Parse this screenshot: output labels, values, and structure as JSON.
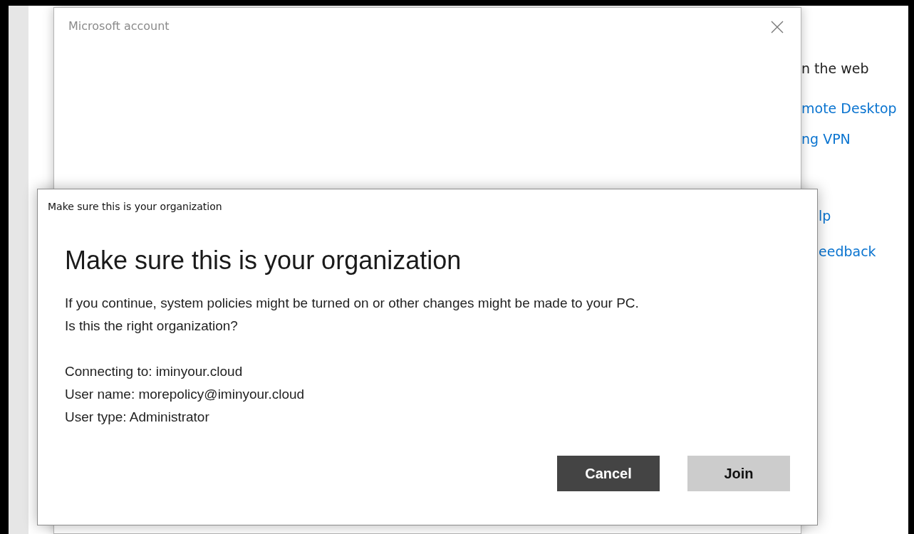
{
  "background_page": {
    "items": [
      {
        "text": "n the web",
        "kind": "plain"
      },
      {
        "text": "mote Desktop",
        "kind": "link"
      },
      {
        "text": "ng VPN",
        "kind": "link"
      },
      {
        "text": "lp",
        "kind": "link"
      },
      {
        "text": "eedback",
        "kind": "link"
      }
    ]
  },
  "account_window": {
    "title": "Microsoft account"
  },
  "dialog": {
    "title": "Make sure this is your organization",
    "heading": "Make sure this is your organization",
    "message": [
      "If you continue, system policies might be turned on or other changes might be made to your PC.",
      "Is this the right organization?"
    ],
    "details": [
      "Connecting to: iminyour.cloud",
      "User name: morepolicy@iminyour.cloud",
      "User type: Administrator"
    ],
    "buttons": [
      {
        "label": "Cancel",
        "kind": "primary"
      },
      {
        "label": "Join",
        "kind": "secondary"
      }
    ]
  }
}
